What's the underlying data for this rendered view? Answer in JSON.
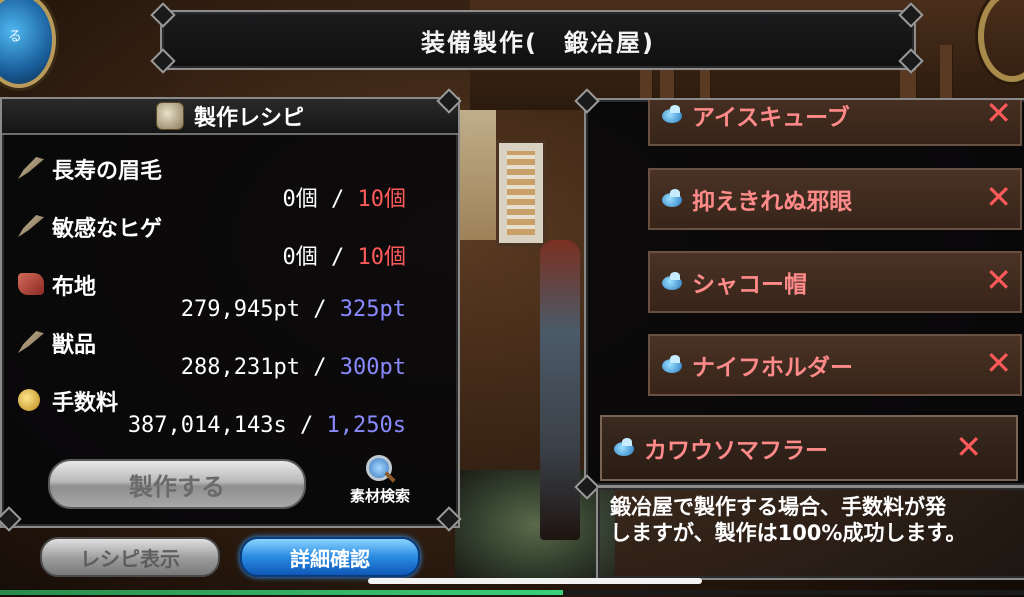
{
  "title": "装備製作(　鍛冶屋)",
  "recipe_panel": {
    "header": "製作レシピ",
    "header_icon": "recipe-scroll-icon",
    "ingredients": [
      {
        "name": "長寿の眉毛",
        "icon": "feather-icon",
        "have": "0個",
        "sep": "/",
        "need": "10個",
        "need_color": "red"
      },
      {
        "name": "敏感なヒゲ",
        "icon": "feather-icon",
        "have": "0個",
        "sep": "/",
        "need": "10個",
        "need_color": "red"
      },
      {
        "name": "布地",
        "icon": "cloth-icon",
        "have": "279,945pt",
        "sep": "/",
        "need": "325pt",
        "need_color": "blue"
      },
      {
        "name": "獣品",
        "icon": "feather-icon",
        "have": "288,231pt",
        "sep": "/",
        "need": "300pt",
        "need_color": "blue"
      },
      {
        "name": "手数料",
        "icon": "coin-icon",
        "have": "387,014,143s",
        "sep": "/",
        "need": "1,250s",
        "need_color": "blue"
      }
    ],
    "craft_button": "製作する",
    "search_label": "素材検索"
  },
  "bottom_buttons": {
    "recipe_show": "レシピ表示",
    "detail": "詳細確認"
  },
  "item_list": [
    {
      "name": "アイスキューブ",
      "remove": "✕"
    },
    {
      "name": "抑えきれぬ邪眼",
      "remove": "✕"
    },
    {
      "name": "シャコー帽",
      "remove": "✕"
    },
    {
      "name": "ナイフホルダー",
      "remove": "✕"
    }
  ],
  "selected_item": {
    "name": "カワウソマフラー",
    "remove": "✕"
  },
  "message": "鍛冶屋で製作する場合、手数料が発\nしますが、製作は100%成功します。",
  "corner_orb_glyph": "る",
  "progress": 0.55,
  "colors": {
    "need_red": "#ff5a5a",
    "need_blue": "#8a8aff",
    "item_text": "#ff8a8a",
    "remove_x": "#ff5a5a"
  }
}
